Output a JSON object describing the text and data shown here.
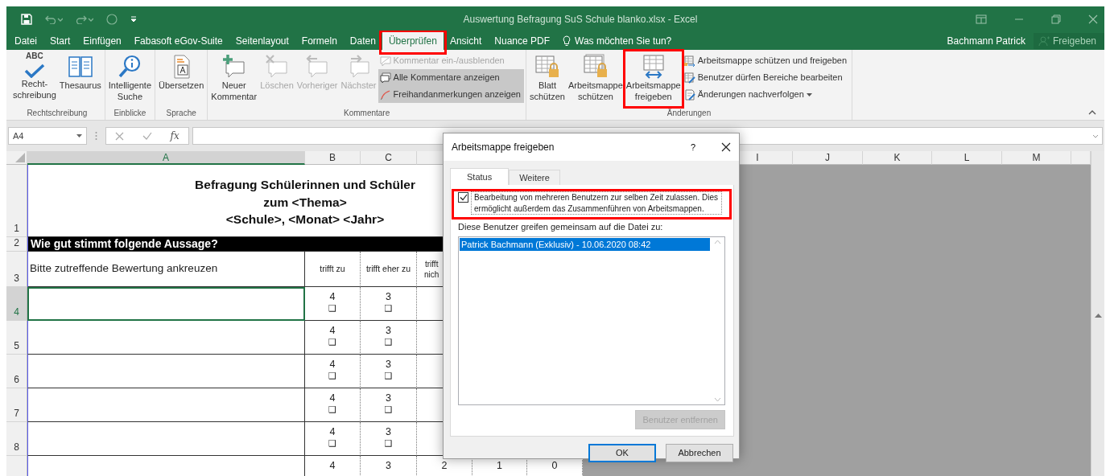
{
  "title_bar": {
    "title": "Auswertung Befragung SuS Schule blanko.xlsx - Excel"
  },
  "ribbon_tabs": [
    {
      "label": "Datei",
      "selected": false
    },
    {
      "label": "Start",
      "selected": false
    },
    {
      "label": "Einfügen",
      "selected": false
    },
    {
      "label": "Fabasoft eGov-Suite",
      "selected": false
    },
    {
      "label": "Seitenlayout",
      "selected": false
    },
    {
      "label": "Formeln",
      "selected": false
    },
    {
      "label": "Daten",
      "selected": false
    },
    {
      "label": "Überprüfen",
      "selected": true,
      "highlighted": true
    },
    {
      "label": "Ansicht",
      "selected": false
    },
    {
      "label": "Nuance PDF",
      "selected": false
    }
  ],
  "tell_me": "Was möchten Sie tun?",
  "account": {
    "user": "Bachmann Patrick",
    "share_button": "Freigeben"
  },
  "ribbon_groups": [
    {
      "label": "Rechtschreibung",
      "buttons": [
        {
          "label": "Recht-\nschreibung",
          "icon_text": "ABC",
          "disabled": false
        },
        {
          "label": "Thesaurus",
          "disabled": false
        }
      ]
    },
    {
      "label": "Einblicke",
      "buttons": [
        {
          "label": "Intelligente\nSuche",
          "disabled": false
        }
      ]
    },
    {
      "label": "Sprache",
      "buttons": [
        {
          "label": "Übersetzen",
          "disabled": false
        }
      ]
    },
    {
      "label": "Kommentare",
      "buttons": [
        {
          "label": "Neuer\nKommentar",
          "disabled": false
        },
        {
          "label": "Löschen",
          "disabled": true
        },
        {
          "label": "Vorheriger",
          "disabled": true
        },
        {
          "label": "Nächster",
          "disabled": true
        }
      ],
      "small_buttons": [
        {
          "label": "Kommentar ein-/ausblenden",
          "disabled": true,
          "active": false
        },
        {
          "label": "Alle Kommentare anzeigen",
          "disabled": false,
          "active": true
        },
        {
          "label": "Freihandanmerkungen anzeigen",
          "disabled": false,
          "active": true
        }
      ]
    },
    {
      "label": "Änderungen",
      "buttons": [
        {
          "label": "Blatt\nschützen",
          "disabled": false
        },
        {
          "label": "Arbeitsmappe\nschützen",
          "disabled": false
        },
        {
          "label": "Arbeitsmappe\nfreigeben",
          "disabled": false,
          "highlighted": true
        }
      ],
      "small_buttons": [
        {
          "label": "Arbeitsmappe schützen und freigeben",
          "disabled": false,
          "active": false
        },
        {
          "label": "Benutzer dürfen Bereiche bearbeiten",
          "disabled": false,
          "active": false
        },
        {
          "label": "Änderungen nachverfolgen",
          "disabled": false,
          "active": false,
          "dropdown": true
        }
      ]
    }
  ],
  "formula_bar": {
    "name_box": "A4",
    "function_label": "fx"
  },
  "column_headers": [
    {
      "label": "A",
      "selected": true
    },
    {
      "label": "B",
      "selected": false
    },
    {
      "label": "C",
      "selected": false
    },
    {
      "label": "I",
      "selected": false
    },
    {
      "label": "J",
      "selected": false
    },
    {
      "label": "K",
      "selected": false
    },
    {
      "label": "L",
      "selected": false
    },
    {
      "label": "M",
      "selected": false
    }
  ],
  "rows": [
    {
      "number": "1",
      "selected": false,
      "kind": "title",
      "text": "Befragung Schülerinnen und Schüler\nzum <Thema>\n<Schule>, <Monat> <Jahr>"
    },
    {
      "number": "2",
      "selected": false,
      "kind": "section",
      "text": "Wie gut stimmt folgende Aussage?"
    },
    {
      "number": "3",
      "selected": false,
      "kind": "header",
      "text": "Bitte zutreffende Bewertung ankreuzen",
      "headings": [
        "trifft zu",
        "trifft eher zu",
        "trifft\nnich"
      ]
    },
    {
      "number": "4",
      "selected": true,
      "kind": "rating",
      "ratings": [
        {
          "value": "4",
          "box": "❑"
        },
        {
          "value": "3",
          "box": "❑"
        }
      ]
    },
    {
      "number": "5",
      "selected": false,
      "kind": "rating",
      "ratings": [
        {
          "value": "4",
          "box": "❑"
        },
        {
          "value": "3",
          "box": "❑"
        }
      ]
    },
    {
      "number": "6",
      "selected": false,
      "kind": "rating",
      "ratings": [
        {
          "value": "4",
          "box": "❑"
        },
        {
          "value": "3",
          "box": "❑"
        }
      ]
    },
    {
      "number": "7",
      "selected": false,
      "kind": "rating",
      "ratings": [
        {
          "value": "4",
          "box": "❑"
        },
        {
          "value": "3",
          "box": "❑"
        }
      ]
    },
    {
      "number": "8",
      "selected": false,
      "kind": "rating",
      "ratings": [
        {
          "value": "4",
          "box": "❑"
        },
        {
          "value": "3",
          "box": "❑"
        }
      ]
    },
    {
      "selected": false,
      "kind": "rating",
      "ratings": [
        {
          "value": "4"
        },
        {
          "value": "3"
        },
        {
          "value": "2"
        },
        {
          "value": "1"
        },
        {
          "value": "0"
        }
      ]
    }
  ],
  "dialog": {
    "title": "Arbeitsmappe freigeben",
    "help": "?",
    "tabs": [
      {
        "label": "Status",
        "selected": true
      },
      {
        "label": "Weitere",
        "selected": false
      }
    ],
    "checkbox": {
      "label": "Bearbeitung von mehreren Benutzern zur selben Zeit zulassen. Dies ermöglicht außerdem das Zusammenführen von Arbeitsmappen.",
      "checked": true,
      "highlighted": true
    },
    "users_label": "Diese Benutzer greifen gemeinsam auf die Datei zu:",
    "users": [
      {
        "label": "Patrick Bachmann (Exklusiv) - 10.06.2020 08:42",
        "selected": true
      }
    ],
    "remove_button": {
      "label": "Benutzer entfernen",
      "disabled": true
    },
    "buttons": [
      {
        "label": "OK",
        "default": true
      },
      {
        "label": "Abbrechen",
        "default": false
      }
    ]
  }
}
